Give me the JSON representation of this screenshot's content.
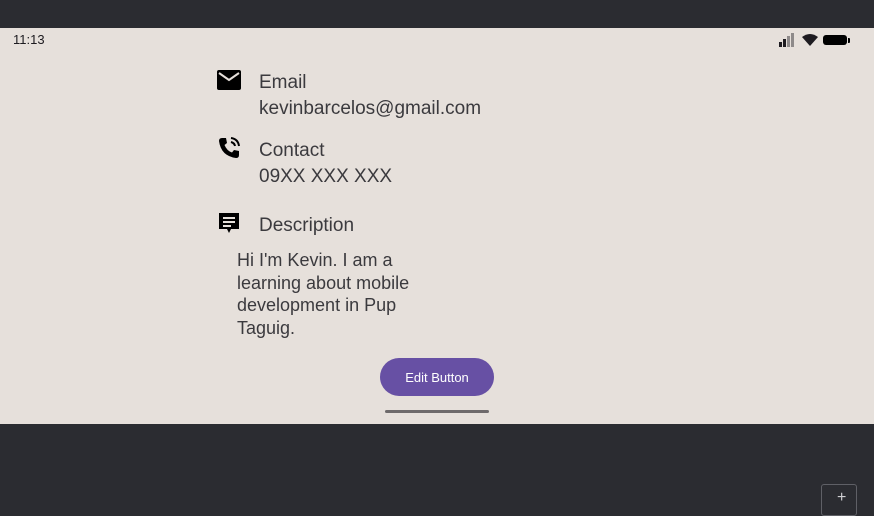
{
  "status_bar": {
    "time": "11:13"
  },
  "profile": {
    "email": {
      "label": "Email",
      "value": "kevinbarcelos@gmail.com"
    },
    "contact": {
      "label": "Contact",
      "value": "09XX XXX XXX"
    },
    "description": {
      "label": "Description",
      "text": "Hi I'm Kevin. I am a learning about mobile development in Pup Taguig."
    }
  },
  "actions": {
    "edit_label": "Edit Button"
  },
  "toolbar": {
    "corner_button": "+"
  },
  "icons": {
    "email": "mail-icon",
    "contact": "phone-in-talk-icon",
    "description": "chat-description-icon"
  },
  "colors": {
    "accent": "#6750a4",
    "background": "#e6e0db",
    "frame": "#2b2c31"
  }
}
